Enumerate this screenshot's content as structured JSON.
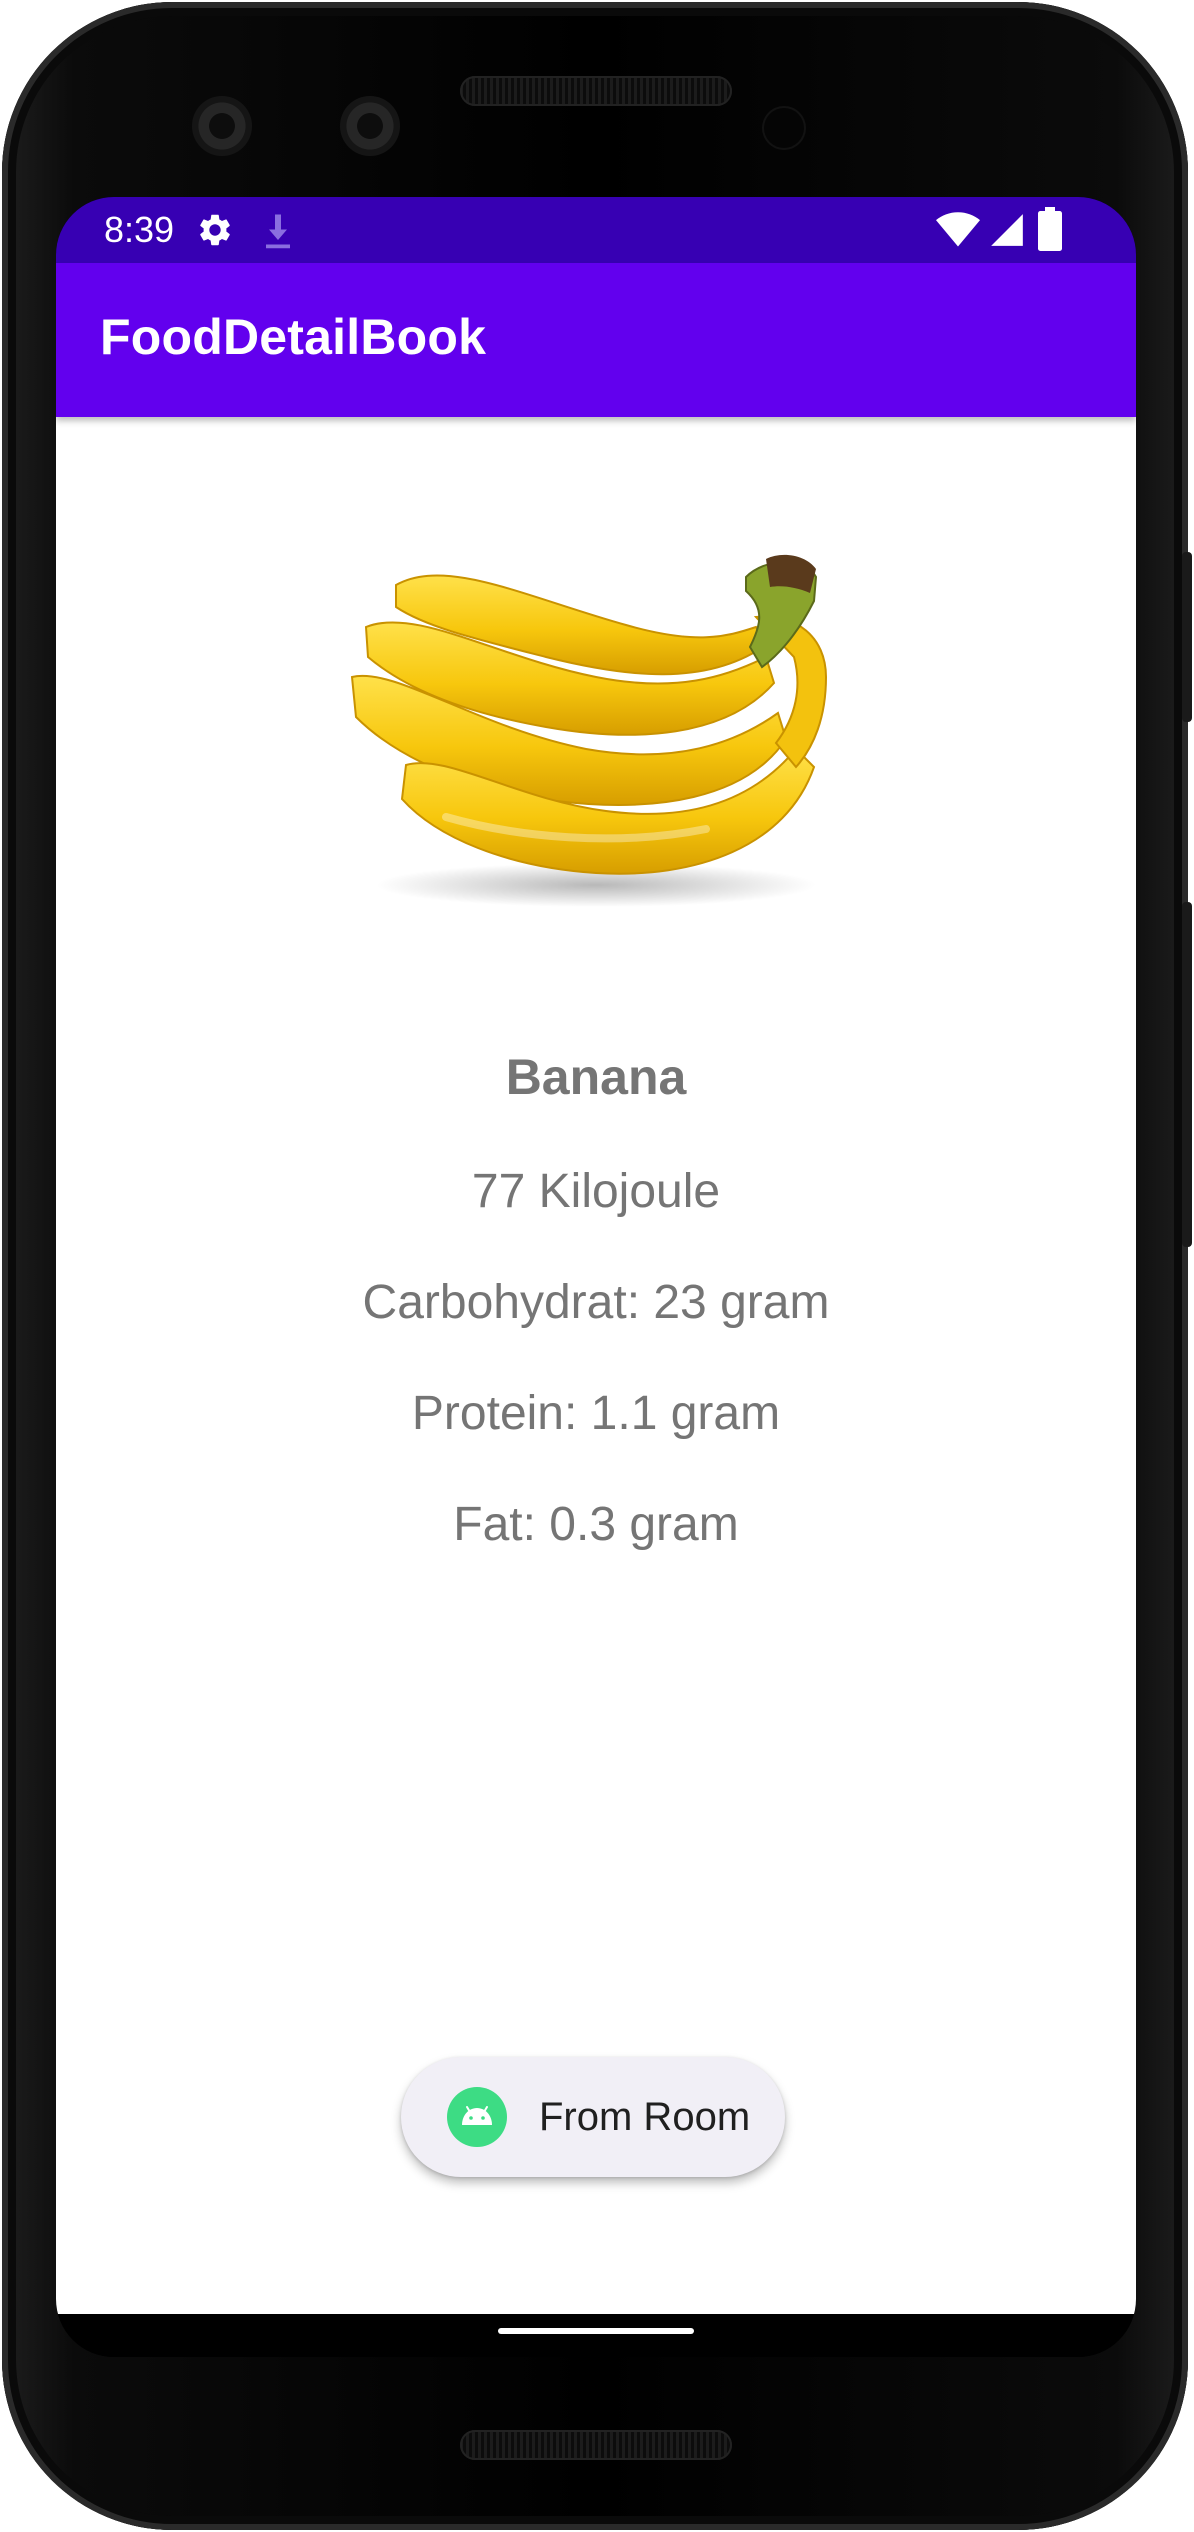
{
  "status_bar": {
    "time": "8:39",
    "left_icons": [
      "gear-icon",
      "download-icon"
    ],
    "right_icons": [
      "wifi-icon",
      "cellular-signal-icon",
      "battery-icon"
    ],
    "color": "#3700b3"
  },
  "app_bar": {
    "title": "FoodDetailBook",
    "color": "#6200ee"
  },
  "food": {
    "image": "banana-image",
    "name": "Banana",
    "energy": "77 Kilojoule",
    "carbohydrate": "Carbohydrat: 23 gram",
    "protein": "Protein: 1.1 gram",
    "fat": "Fat: 0.3 gram",
    "text_color": "#757575"
  },
  "fab": {
    "label": "From Room",
    "icon": "android-icon",
    "background": "#f1eff6"
  },
  "nav": {
    "handle": "home-handle"
  }
}
